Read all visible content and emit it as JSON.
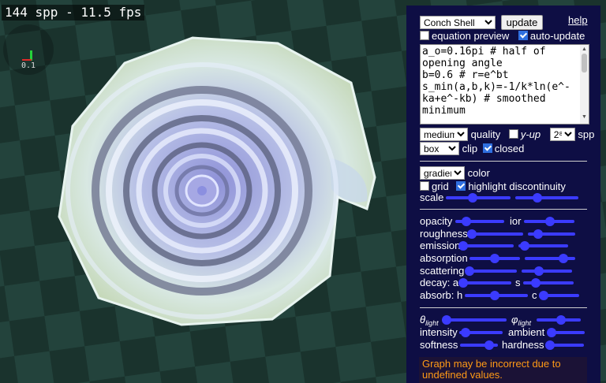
{
  "stats": {
    "text": "144 spp - 11.5 fps"
  },
  "axes": {
    "scale_label": "0.1"
  },
  "controls": {
    "preset": {
      "selected": "Conch Shell"
    },
    "update_label": "update",
    "help_label": "help",
    "equation_preview": {
      "label": "equation preview",
      "checked": false
    },
    "auto_update": {
      "label": "auto-update",
      "checked": true
    },
    "code": "a_o=0.16pi # half of opening angle\nb=0.6 # r=e^bt\ns_min(a,b,k)=-1/k*ln(e^-ka+e^-kb) # smoothed minimum\n\n# Cross section",
    "quality": {
      "selected": "medium",
      "label": "quality"
    },
    "y_up": {
      "label": "y-up",
      "checked": false
    },
    "spp": {
      "selected": "2⁸",
      "label": "spp"
    },
    "clip": {
      "selected": "box",
      "label": "clip"
    },
    "closed": {
      "label": "closed",
      "checked": true
    },
    "color": {
      "selected": "gradient",
      "label": "color"
    },
    "grid": {
      "label": "grid",
      "checked": false
    },
    "highlight_discontinuity": {
      "label": "highlight discontinuity",
      "checked": true
    },
    "scale": {
      "label": "scale",
      "left": 0.42,
      "right": 0.35
    }
  },
  "material": {
    "opacity": {
      "label": "opacity",
      "value": 0.22
    },
    "ior": {
      "label": "ior",
      "value": 0.52
    },
    "roughness": {
      "label": "roughness",
      "value": 0.05
    },
    "roughness2": {
      "value": 0.22
    },
    "emission": {
      "label": "emission",
      "value": 0.02
    },
    "emission2": {
      "value": 0.12
    },
    "absorption": {
      "label": "absorption",
      "value": 0.5
    },
    "absorption2": {
      "value": 0.77
    },
    "scattering": {
      "label": "scattering",
      "value": 0.06
    },
    "scattering2": {
      "value": 0.35
    },
    "decay_a": {
      "label": "decay: a",
      "value": 0.05
    },
    "decay_s": {
      "label": "s",
      "value": 0.25
    },
    "absorb_h": {
      "label": "absorb: h",
      "value": 0.47
    },
    "absorb_c": {
      "label": "c",
      "value": 0.1
    }
  },
  "lighting": {
    "theta": {
      "label": "θ",
      "sub": "light",
      "value": 0.05
    },
    "phi": {
      "label": "φ",
      "sub": "light",
      "value": 0.55
    },
    "intensity": {
      "label": "intensity",
      "value": 0.14
    },
    "ambient": {
      "label": "ambient",
      "value": 0.08
    },
    "softness": {
      "label": "softness",
      "value": 0.78
    },
    "hardness": {
      "label": "hardness",
      "value": 0.1
    }
  },
  "warning": "Graph may be incorrect due to undefined values."
}
